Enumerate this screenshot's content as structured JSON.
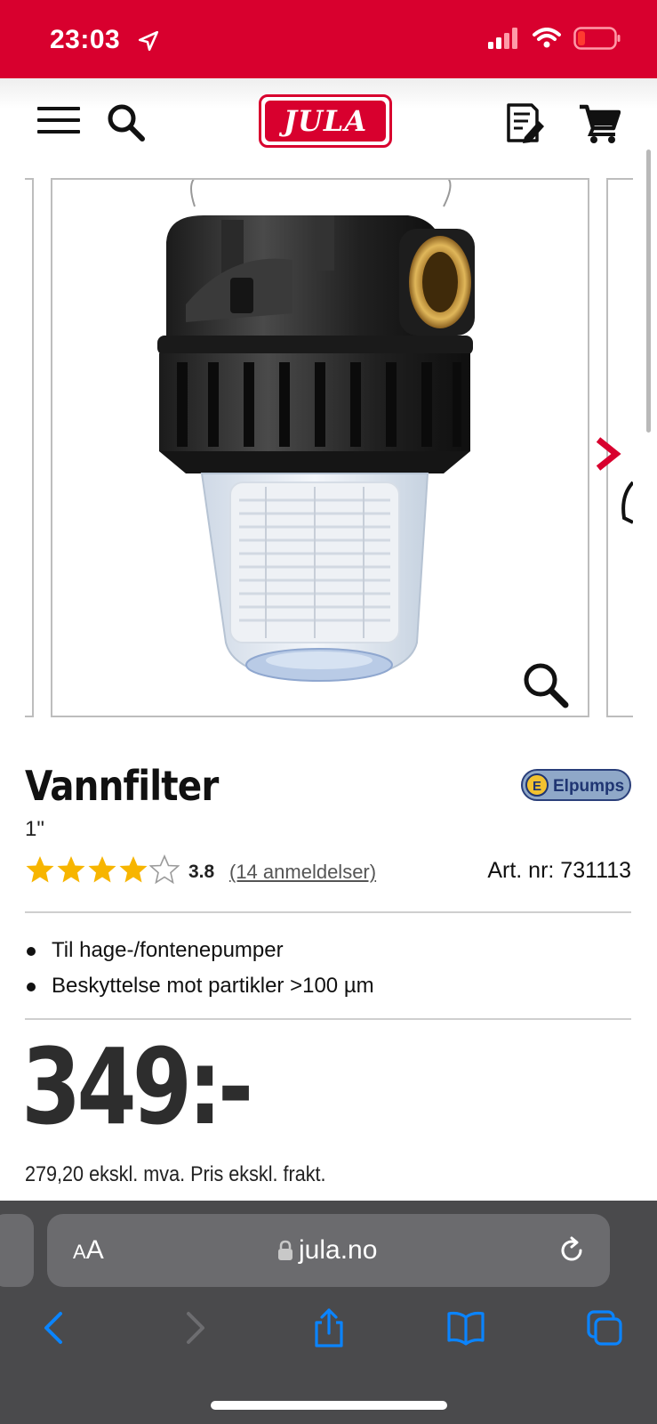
{
  "status_bar": {
    "time": "23:03",
    "icons": [
      "location-arrow-icon",
      "signal-icon",
      "wifi-icon",
      "battery-icon"
    ],
    "bg_color": "#d8002e",
    "battery_color": "#ff3b30"
  },
  "header": {
    "logo_text": "JULA",
    "icons": [
      "menu-icon",
      "search-icon",
      "shopping-list-icon",
      "cart-icon"
    ],
    "brand_color": "#d8002e"
  },
  "gallery": {
    "image_alt": "Vannfilter",
    "icons": [
      "chevron-right-icon",
      "zoom-icon"
    ]
  },
  "product": {
    "title": "Vannfilter",
    "variant": "1\"",
    "brand_logo_text": "Elpumps",
    "rating": 3.8,
    "rating_text": "3.8",
    "stars_filled": 4,
    "stars_total": 5,
    "reviews_link": "(14 anmeldelser)",
    "article_number": "Art. nr: 731113",
    "bullets": [
      "Til hage-/fontenepumper",
      "Beskyttelse mot partikler >100 µm"
    ],
    "price": "349:-",
    "price_note": "279,20 ekskl. mva. Pris ekskl. frakt.",
    "star_color": "#f7b500"
  },
  "browser": {
    "aa_label_small": "A",
    "aa_label_big": "A",
    "url": "jula.no",
    "icons": [
      "lock-icon",
      "reload-icon",
      "back-icon",
      "forward-icon",
      "share-icon",
      "bookmarks-icon",
      "tabs-icon"
    ],
    "accent_color": "#0a84ff"
  }
}
